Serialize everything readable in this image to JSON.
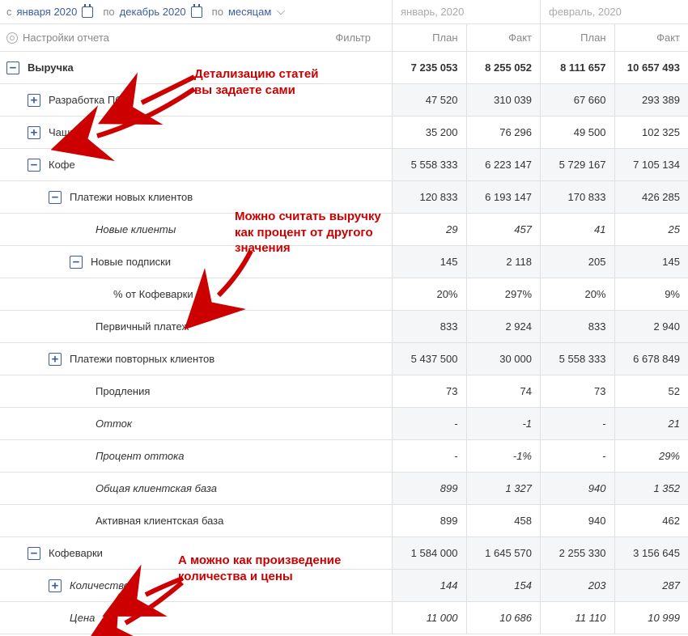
{
  "toolbar": {
    "from_prefix": "с",
    "from": "января 2020",
    "to_prefix": "по",
    "to": "декабрь 2020",
    "period_prefix": "по",
    "period": "месяцам"
  },
  "subbar": {
    "settings": "Настройки отчета",
    "filter": "Фильтр"
  },
  "months": [
    {
      "title": "январь, 2020"
    },
    {
      "title": "февраль, 2020"
    }
  ],
  "subheaders": {
    "plan": "План",
    "fact": "Факт"
  },
  "rows": [
    {
      "label": "Выручка",
      "toggle": "-",
      "indent": 0,
      "bold": true,
      "alt": true,
      "cells": [
        "7 235 053",
        "8 255 052",
        "8 111 657",
        "10 657 493"
      ]
    },
    {
      "label": "Разработка ПО",
      "toggle": "+",
      "indent": 1,
      "cells": [
        "47 520",
        "310 039",
        "67 660",
        "293 389"
      ]
    },
    {
      "label": "Чашки",
      "toggle": "+",
      "indent": 1,
      "alt": true,
      "cells": [
        "35 200",
        "76 296",
        "49 500",
        "102 325"
      ]
    },
    {
      "label": "Кофе",
      "toggle": "-",
      "indent": 1,
      "cells": [
        "5 558 333",
        "6 223 147",
        "5 729 167",
        "7 105 134"
      ]
    },
    {
      "label": "Платежи новых клиентов",
      "toggle": "-",
      "indent": 2,
      "cells": [
        "120 833",
        "6 193 147",
        "170 833",
        "426 285"
      ]
    },
    {
      "label": "Новые клиенты",
      "indent": 3,
      "italic": true,
      "alt": true,
      "ind_cls": "ind4",
      "cells": [
        "29",
        "457",
        "41",
        "25"
      ]
    },
    {
      "label": "Новые подписки",
      "toggle": "-",
      "indent": 3,
      "ind_cls": "ind3",
      "cells": [
        "145",
        "2 118",
        "205",
        "145"
      ]
    },
    {
      "label": "% от Кофеварки",
      "indent": 4,
      "ind_cls": "ind5",
      "alt": true,
      "cells": [
        "20%",
        "297%",
        "20%",
        "9%"
      ]
    },
    {
      "label": "Первичный платеж",
      "indent": 3,
      "ind_cls": "ind4",
      "cells": [
        "833",
        "2 924",
        "833",
        "2 940"
      ]
    },
    {
      "label": "Платежи повторных клиентов",
      "toggle": "+",
      "indent": 2,
      "cells": [
        "5 437 500",
        "30 000",
        "5 558 333",
        "6 678 849"
      ]
    },
    {
      "label": "Продления",
      "indent": 3,
      "ind_cls": "ind4",
      "alt": true,
      "cells": [
        "73",
        "74",
        "73",
        "52"
      ]
    },
    {
      "label": "Отток",
      "indent": 3,
      "italic": true,
      "ind_cls": "ind4",
      "cells": [
        "-",
        "-1",
        "-",
        "21"
      ]
    },
    {
      "label": "Процент оттока",
      "indent": 3,
      "italic": true,
      "ind_cls": "ind4",
      "alt": true,
      "cells": [
        "-",
        "-1%",
        "-",
        "29%"
      ]
    },
    {
      "label": "Общая клиентская база",
      "indent": 3,
      "italic": true,
      "ind_cls": "ind4",
      "cells": [
        "899",
        "1 327",
        "940",
        "1 352"
      ]
    },
    {
      "label": "Активная клиентская база",
      "indent": 3,
      "ind_cls": "ind4",
      "alt": true,
      "cells": [
        "899",
        "458",
        "940",
        "462"
      ]
    },
    {
      "label": "Кофеварки",
      "toggle": "-",
      "indent": 1,
      "cells": [
        "1 584 000",
        "1 645 570",
        "2 255 330",
        "3 156 645"
      ]
    },
    {
      "label": "Количество",
      "toggle": "+",
      "indent": 2,
      "italic": true,
      "cells": [
        "144",
        "154",
        "203",
        "287"
      ]
    },
    {
      "label": "Цена",
      "indent": 2,
      "italic": true,
      "ind_cls": "ind3",
      "alt": true,
      "cells": [
        "11 000",
        "10 686",
        "11 110",
        "10 999"
      ]
    }
  ],
  "annotations": {
    "a1": "Детализацию статей\nвы задаете сами",
    "a2": "Можно считать выручку\nкак процент от другого\nзначения",
    "a3": "А можно как произведение\nколичества и цены"
  }
}
